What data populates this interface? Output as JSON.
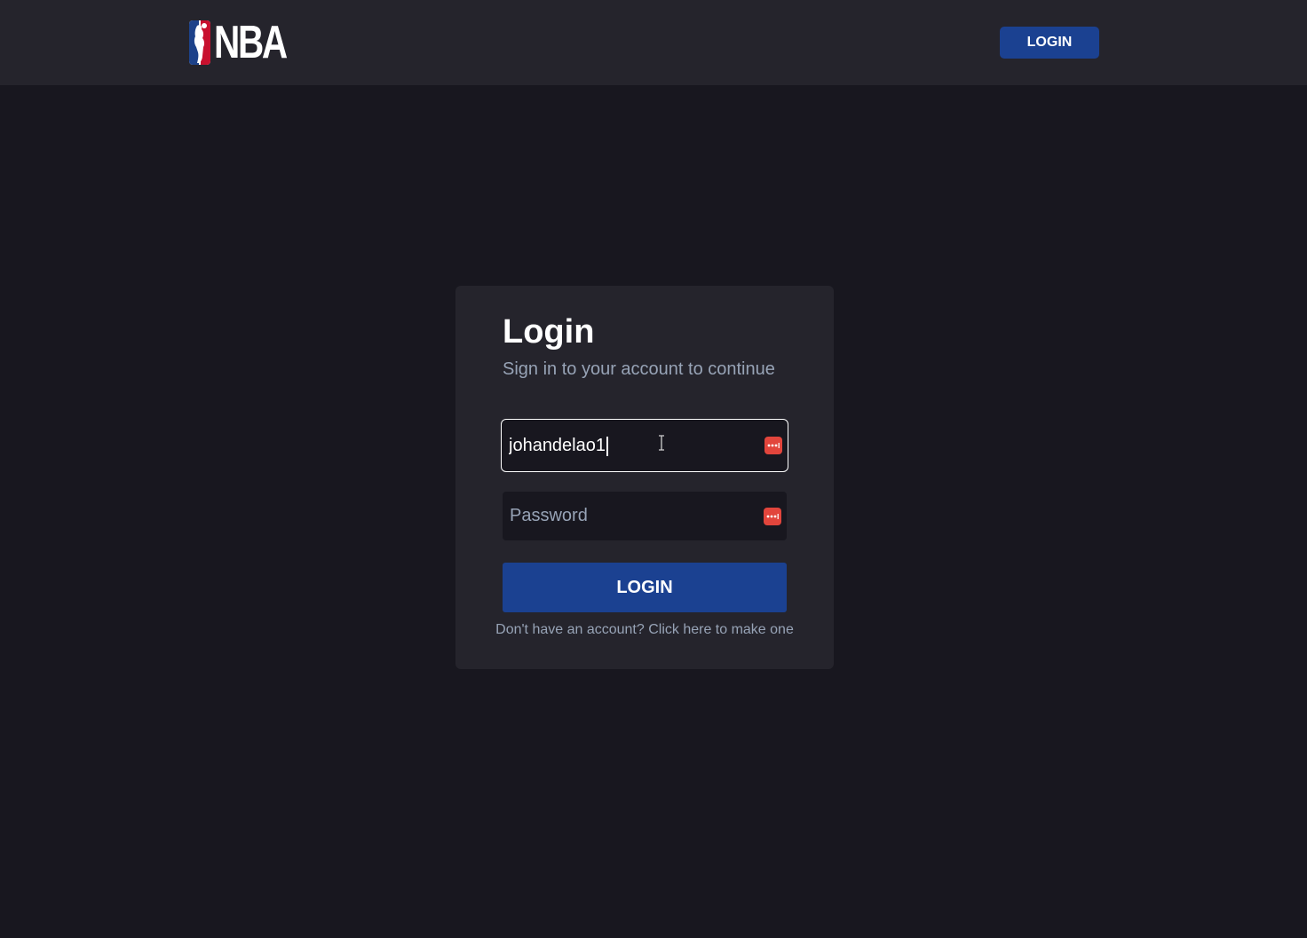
{
  "header": {
    "logo_text": "NBA",
    "login_label": "LOGIN"
  },
  "login_card": {
    "title": "Login",
    "subtitle": "Sign in to your account to continue",
    "username": {
      "value": "johandelao1"
    },
    "password": {
      "value": "",
      "placeholder": "Password"
    },
    "submit_label": "LOGIN",
    "signup_text": "Don't have an account? Click here to make one"
  },
  "colors": {
    "page_background": "#18171f",
    "surface": "#25242c",
    "brand_blue": "#1b4191",
    "password_manager_red": "#e2453c",
    "muted_text": "#97a3b6"
  },
  "icons": {
    "logo": "nba-logo-icon",
    "password_manager": "password-manager-icon",
    "text_cursor": "text-cursor-icon"
  }
}
